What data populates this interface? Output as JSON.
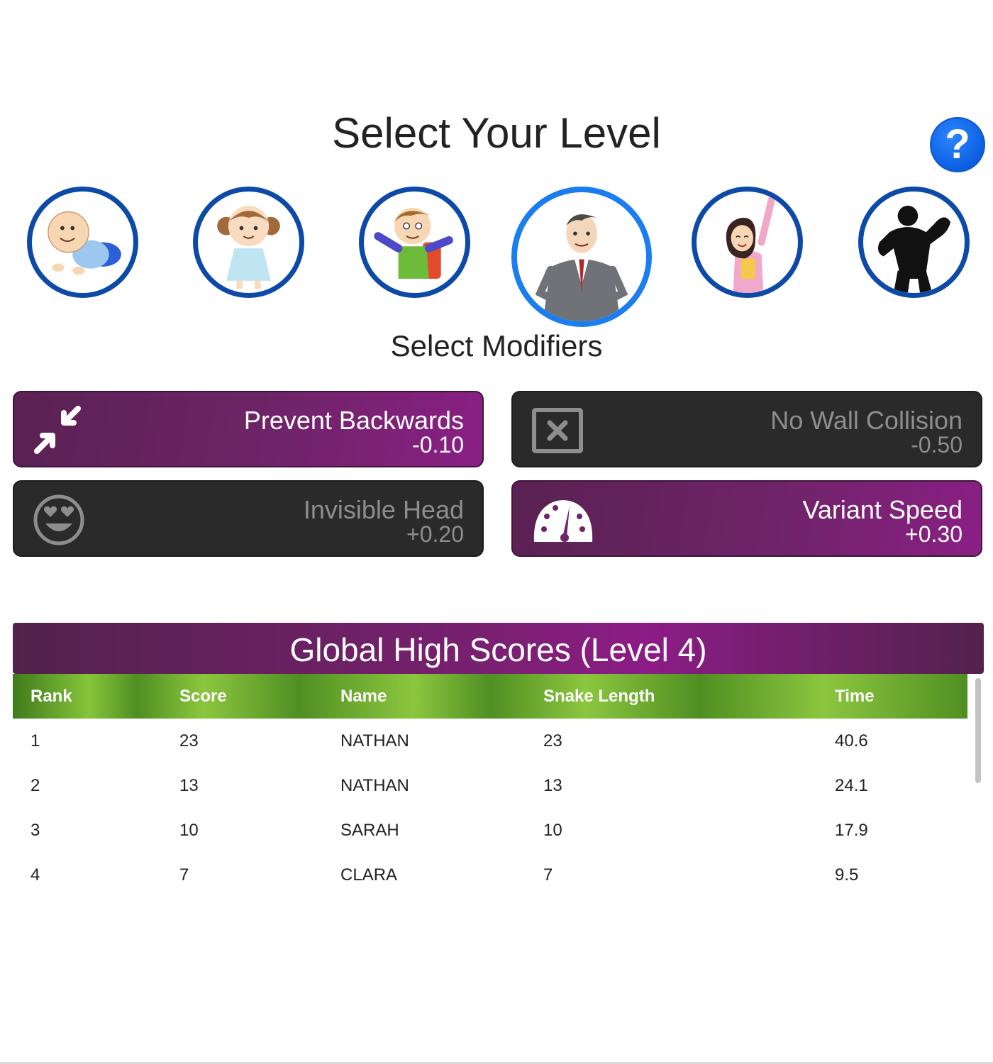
{
  "level_select": {
    "title": "Select Your Level",
    "help_label": "?",
    "levels": [
      {
        "name": "baby",
        "selected": false
      },
      {
        "name": "toddler-girl",
        "selected": false
      },
      {
        "name": "schoolboy",
        "selected": false
      },
      {
        "name": "businessman",
        "selected": true
      },
      {
        "name": "woman",
        "selected": false
      },
      {
        "name": "bodybuilder",
        "selected": false
      }
    ]
  },
  "modifiers": {
    "title": "Select Modifiers",
    "items": [
      {
        "name": "Prevent Backwards",
        "value": "-0.10",
        "active": true,
        "icon": "compress-arrows-icon"
      },
      {
        "name": "No Wall Collision",
        "value": "-0.50",
        "active": false,
        "icon": "box-x-icon"
      },
      {
        "name": "Invisible Head",
        "value": "+0.20",
        "active": false,
        "icon": "heart-eyes-icon"
      },
      {
        "name": "Variant Speed",
        "value": "+0.30",
        "active": true,
        "icon": "speedometer-icon"
      }
    ]
  },
  "high_scores": {
    "title": "Global High Scores (Level 4)",
    "columns": [
      "Rank",
      "Score",
      "Name",
      "Snake Length",
      "Time"
    ],
    "rows": [
      [
        "1",
        "23",
        "NATHAN",
        "23",
        "40.6"
      ],
      [
        "2",
        "13",
        "NATHAN",
        "13",
        "24.1"
      ],
      [
        "3",
        "10",
        "SARAH",
        "10",
        "17.9"
      ],
      [
        "4",
        "7",
        "CLARA",
        "7",
        "9.5"
      ]
    ]
  },
  "colors": {
    "accent_purple": "#7a2072",
    "inactive_dark": "#2a2a2a",
    "level_border": "#0d4aa8",
    "selected_border": "#1a7df0",
    "table_header_green": "#86c53a"
  }
}
